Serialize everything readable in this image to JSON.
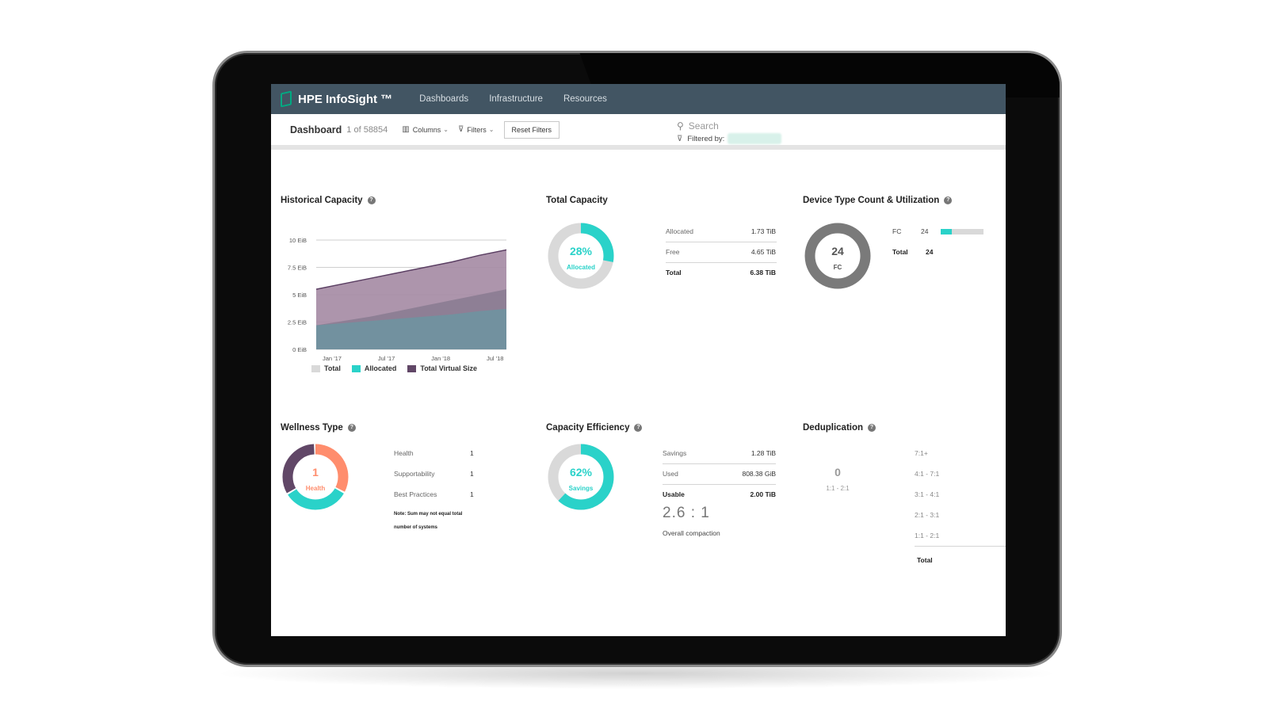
{
  "nav": {
    "brand": "HPE InfoSight ™",
    "items": [
      "Dashboards",
      "Infrastructure",
      "Resources"
    ]
  },
  "toolbar": {
    "title": "Dashboard",
    "count": "1 of 58854",
    "columns_label": "Columns",
    "filters_label": "Filters",
    "reset_label": "Reset Filters",
    "search_placeholder": "Search",
    "filtered_by_label": "Filtered by:"
  },
  "historical": {
    "title": "Historical Capacity",
    "y_ticks": [
      "10 EiB",
      "7.5 EiB",
      "5 EiB",
      "2.5 EiB",
      "0 EiB"
    ],
    "x_ticks": [
      "Jan '17",
      "Jul '17",
      "Jan '18",
      "Jul '18"
    ],
    "legend": [
      {
        "label": "Total",
        "color": "#d9d9d9"
      },
      {
        "label": "Allocated",
        "color": "#2ad2c9"
      },
      {
        "label": "Total Virtual Size",
        "color": "#614767"
      }
    ]
  },
  "chart_data": {
    "type": "area",
    "x": [
      "Jan '17",
      "Apr '17",
      "Jul '17",
      "Oct '17",
      "Jan '18",
      "Apr '18",
      "Jul '18",
      "Sep '18"
    ],
    "ylim": [
      0,
      10
    ],
    "series": [
      {
        "name": "Total",
        "values": [
          5.5,
          6.0,
          6.5,
          7.0,
          7.5,
          8.0,
          8.6,
          9.1
        ]
      },
      {
        "name": "Total Virtual Size",
        "values": [
          2.2,
          2.6,
          3.0,
          3.5,
          4.0,
          4.5,
          5.0,
          5.5
        ]
      },
      {
        "name": "Allocated",
        "values": [
          2.2,
          2.4,
          2.6,
          2.8,
          3.0,
          3.2,
          3.5,
          3.7
        ]
      }
    ],
    "colors": {
      "total": "#a48aa3",
      "virtual": "#8b7c92",
      "allocated": "#6f94a0",
      "line": "#5b3f63"
    }
  },
  "total_capacity": {
    "title": "Total Capacity",
    "percent": "28%",
    "percent_label": "Allocated",
    "fraction": 0.28,
    "rows": [
      {
        "label": "Allocated",
        "value": "1.73 TiB"
      },
      {
        "label": "Free",
        "value": "4.65 TiB"
      },
      {
        "label": "Total",
        "value": "6.38 TiB"
      }
    ]
  },
  "device": {
    "title": "Device Type Count & Utilization",
    "center_value": "24",
    "center_label": "FC",
    "rows": [
      {
        "label": "FC",
        "value": "24"
      },
      {
        "label": "Total",
        "value": "24"
      }
    ],
    "bar_fraction": 0.25
  },
  "wellness": {
    "title": "Wellness Type",
    "center_value": "1",
    "center_label": "Health",
    "rows": [
      {
        "label": "Health",
        "value": "1"
      },
      {
        "label": "Supportability",
        "value": "1"
      },
      {
        "label": "Best Practices",
        "value": "1"
      }
    ],
    "note_line1": "Note: Sum may not equal total",
    "note_line2": "number of systems",
    "colors": [
      "#ff8d6d",
      "#2ad2c9",
      "#614767"
    ]
  },
  "efficiency": {
    "title": "Capacity Efficiency",
    "percent": "62%",
    "percent_label": "Savings",
    "fraction": 0.62,
    "rows": [
      {
        "label": "Savings",
        "value": "1.28 TiB"
      },
      {
        "label": "Used",
        "value": "808.38 GiB"
      },
      {
        "label": "Usable",
        "value": "2.00 TiB"
      }
    ],
    "ratio": "2.6 : 1",
    "ratio_label": "Overall compaction"
  },
  "dedup": {
    "title": "Deduplication",
    "center_value": "0",
    "center_label": "1:1 - 2:1",
    "ranges": [
      "7:1+",
      "4:1 - 7:1",
      "3:1 - 4:1",
      "2:1 - 3:1",
      "1:1 - 2:1"
    ],
    "total_label": "Total"
  }
}
